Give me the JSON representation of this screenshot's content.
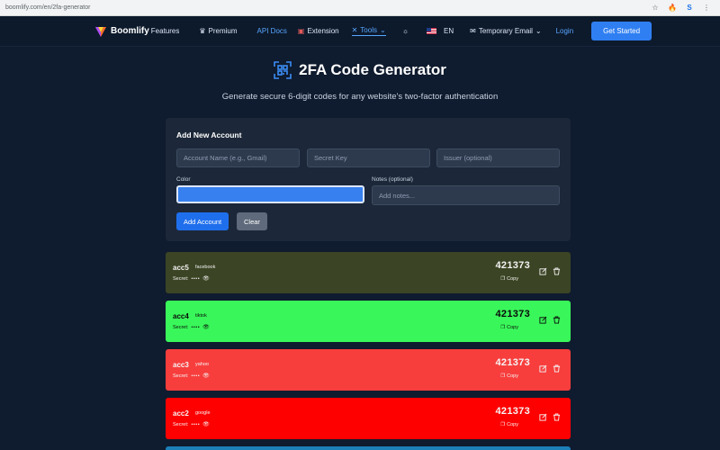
{
  "browser": {
    "url": "boomlify.com/en/2fa-generator",
    "icons": [
      "bookmark-star-icon",
      "fire-extension-icon",
      "boomlify-extension-icon",
      "menu-dots-icon"
    ]
  },
  "nav": {
    "brand": "Boomlify",
    "features": "Features",
    "premium": "Premium",
    "api_docs": "API Docs",
    "extension": "Extension",
    "tools": "Tools",
    "lang": "EN",
    "temp_email": "Temporary Email",
    "login": "Login",
    "get_started": "Get Started"
  },
  "hero": {
    "title": "2FA Code Generator",
    "subtitle": "Generate secure 6-digit codes for any website's two-factor authentication"
  },
  "form": {
    "heading": "Add New Account",
    "account_placeholder": "Account Name (e.g., Gmail)",
    "secret_placeholder": "Secret Key",
    "issuer_placeholder": "Issuer (optional)",
    "color_label": "Color",
    "color_value": "#3780f0",
    "notes_label": "Notes (optional)",
    "notes_placeholder": "Add notes...",
    "add_button": "Add Account",
    "clear_button": "Clear"
  },
  "accounts": [
    {
      "name": "acc5",
      "issuer": "facebook",
      "secret_label": "Secret:",
      "secret_mask": "••••",
      "code": "421373",
      "copy": "Copy",
      "color": "#3b4424",
      "text": "light"
    },
    {
      "name": "acc4",
      "issuer": "tiktok",
      "secret_label": "Secret:",
      "secret_mask": "••••",
      "code": "421373",
      "copy": "Copy",
      "color": "#39f75a",
      "text": "dark"
    },
    {
      "name": "acc3",
      "issuer": "yahoo",
      "secret_label": "Secret:",
      "secret_mask": "••••",
      "code": "421373",
      "copy": "Copy",
      "color": "#f73e3d",
      "text": "light"
    },
    {
      "name": "acc2",
      "issuer": "google",
      "secret_label": "Secret:",
      "secret_mask": "••••",
      "code": "421373",
      "copy": "Copy",
      "color": "#ff0000",
      "text": "light"
    }
  ],
  "colors": {
    "page_bg": "#0f1b2e",
    "card_bg": "#1c2839",
    "accent": "#2f7ff2",
    "link": "#58a6ff"
  }
}
